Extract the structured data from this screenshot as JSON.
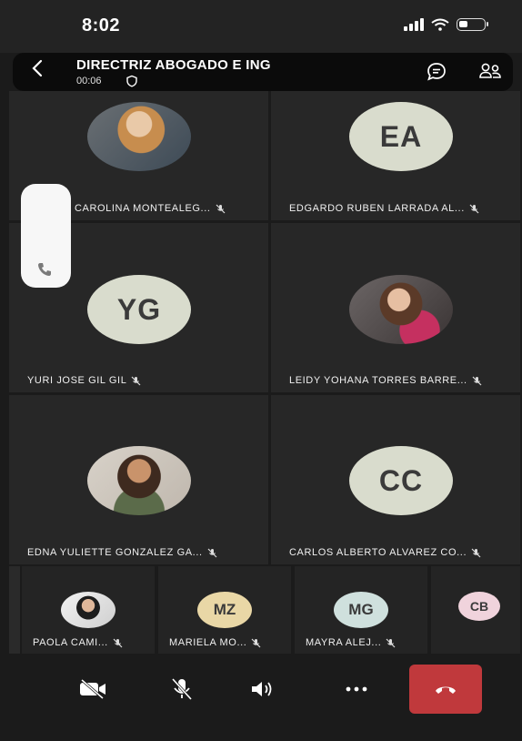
{
  "status_bar": {
    "time": "8:02"
  },
  "call": {
    "title": "DIRECTRIZ ABOGADO E ING",
    "duration": "00:06"
  },
  "participants": [
    {
      "name": "CAROLINA MONTEALEG...",
      "initials": "",
      "muted": true
    },
    {
      "name": "EDGARDO RUBEN LARRADA AL...",
      "initials": "EA",
      "muted": true
    },
    {
      "name": "YURI JOSE GIL GIL",
      "initials": "YG",
      "muted": true
    },
    {
      "name": "LEIDY YOHANA TORRES BARRE...",
      "initials": "",
      "muted": true
    },
    {
      "name": "EDNA YULIETTE GONZALEZ GA...",
      "initials": "",
      "muted": true
    },
    {
      "name": "CARLOS ALBERTO ALVAREZ CO...",
      "initials": "CC",
      "muted": true
    }
  ],
  "strip": [
    {
      "name": "PAOLA CAMI...",
      "initials": "",
      "muted": true
    },
    {
      "name": "MARIELA MO...",
      "initials": "MZ",
      "avatar_color": "#e9d7a6"
    },
    {
      "name": "MAYRA ALEJ...",
      "initials": "MG",
      "avatar_color": "#cfe0dd"
    },
    {
      "name": "",
      "initials": "CB",
      "avatar_color": "#f0d3dc"
    }
  ],
  "controls": [
    {
      "name": "camera-off",
      "icon": "video-off-icon"
    },
    {
      "name": "mic-off",
      "icon": "mic-off-icon"
    },
    {
      "name": "speaker",
      "icon": "speaker-icon"
    },
    {
      "name": "more",
      "icon": "more-icon"
    },
    {
      "name": "end-call",
      "icon": "hang-up-icon",
      "color": "#c0393c"
    }
  ]
}
